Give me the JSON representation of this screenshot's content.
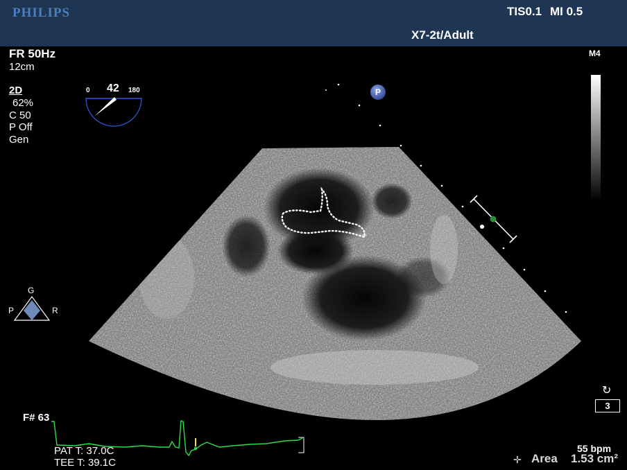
{
  "header": {
    "brand": "PHILIPS",
    "tis": "TIS0.1",
    "mi": "MI 0.5",
    "probe": "X7-2t/Adult"
  },
  "imaging": {
    "frame_rate": "FR 50Hz",
    "depth": "12cm",
    "mode": "2D",
    "gain": "62%",
    "compression": "C 50",
    "persistence": "P Off",
    "preset": "Gen"
  },
  "angle": {
    "min": "0",
    "value": "42",
    "max": "180"
  },
  "orientation": {
    "top": "G",
    "left": "P",
    "right": "R"
  },
  "map": {
    "label": "M4"
  },
  "position_marker": "P",
  "footer": {
    "frame_number": "F# 63",
    "patient_temp": "PAT T: 37.0C",
    "tee_temp": "TEE T: 39.1C",
    "heart_rate": "55 bpm",
    "measure_label": "Area",
    "measure_value": "1.53 cm²",
    "loop_count": "3"
  },
  "colors": {
    "header_bg": "#1e3654",
    "brand": "#4a7fc0",
    "ecg": "#2ee04a",
    "marker": "#3a4f9c"
  },
  "icons": {
    "measure": "crosshair-icon",
    "loop": "cine-loop-icon",
    "angle": "multiplane-angle-icon",
    "orientation": "orientation-diamond-icon"
  }
}
